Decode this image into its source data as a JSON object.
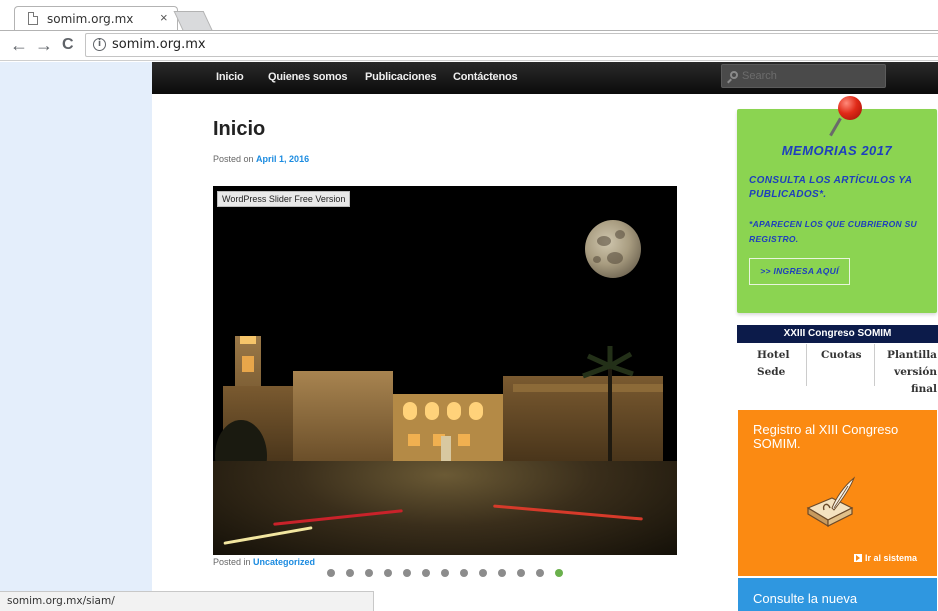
{
  "browser": {
    "tab_title": "somim.org.mx",
    "tab_close": "×",
    "url": "somim.org.mx",
    "back": "←",
    "forward": "→",
    "reload": "C",
    "info": "i"
  },
  "nav": {
    "items": [
      "Inicio",
      "Quienes somos",
      "Publicaciones",
      "Contáctenos"
    ],
    "search_placeholder": "Search"
  },
  "post": {
    "title": "Inicio",
    "posted_on_prefix": "Posted on",
    "date": "April 1, 2016",
    "slider_label": "WordPress Slider Free Version",
    "posted_in_prefix": "Posted in",
    "category": "Uncategorized",
    "slide_count": 13,
    "active_slide": 13
  },
  "sidebar": {
    "memorias": {
      "title": "MEMORIAS 2017",
      "text1": "CONSULTA LOS ARTÍCULOS YA PUBLICADOS*.",
      "text2": "*APARECEN LOS QUE CUBRIERON SU REGISTRO.",
      "button": ">> INGRESA AQUÍ",
      "color": "#8bd451",
      "text_color": "#1e3fbd"
    },
    "congreso": {
      "title": "XXIII Congreso SOMIM",
      "link1_line1": "Hotel",
      "link1_line2": "Sede",
      "link2": "Cuotas",
      "link3_line1": "Plantilla",
      "link3_line2": "versión",
      "link3_line3": "final"
    },
    "registro": {
      "text": "Registro al XIII Congreso SOMIM.",
      "link": "Ir al sistema",
      "color": "#fb8a12"
    },
    "consulte": {
      "text": "Consulte la nueva",
      "color": "#2f97e0"
    }
  },
  "status": {
    "url": "somim.org.mx/siam/"
  }
}
